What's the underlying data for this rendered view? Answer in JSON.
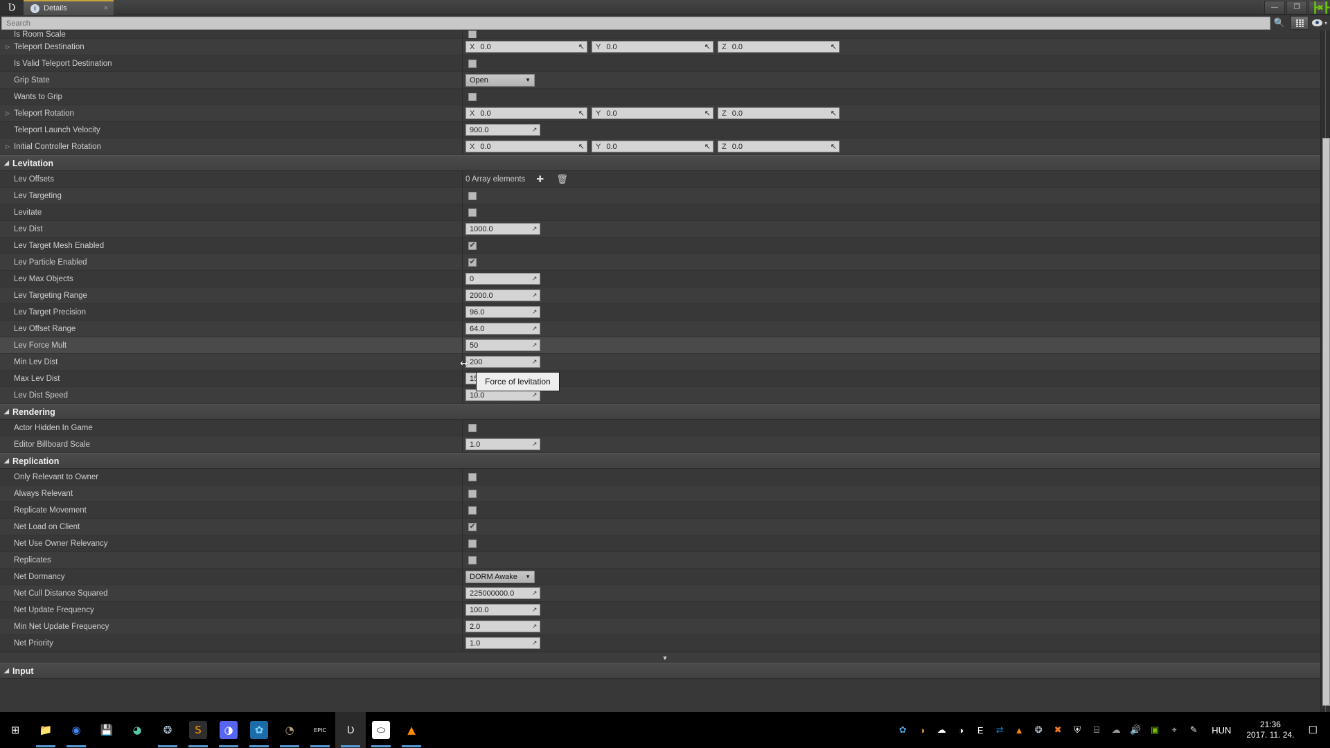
{
  "window": {
    "tab_label": "Details",
    "tab_icon": "info-icon",
    "tab_close": "×",
    "logo": "Ʋ",
    "minimize": "—",
    "restore": "❐",
    "close_overlay": "┣✖┣"
  },
  "search": {
    "placeholder": "Search",
    "value": "",
    "search_icon": "🔍",
    "eye_icon": "eye-icon",
    "chevron": "▾"
  },
  "rows": [
    {
      "label": "Is Room Scale",
      "type": "checkbox",
      "checked": false,
      "expander": false,
      "partial": true
    },
    {
      "label": "Teleport Destination",
      "type": "vector",
      "expander": true,
      "vector": [
        {
          "axis": "X",
          "value": "0.0"
        },
        {
          "axis": "Y",
          "value": "0.0"
        },
        {
          "axis": "Z",
          "value": "0.0"
        }
      ]
    },
    {
      "label": "Is Valid Teleport Destination",
      "type": "checkbox",
      "checked": false,
      "expander": false
    },
    {
      "label": "Grip State",
      "type": "combo",
      "value": "Open",
      "expander": false
    },
    {
      "label": "Wants to Grip",
      "type": "checkbox",
      "checked": false,
      "expander": false
    },
    {
      "label": "Teleport Rotation",
      "type": "vector",
      "expander": true,
      "vector": [
        {
          "axis": "X",
          "value": "0.0"
        },
        {
          "axis": "Y",
          "value": "0.0"
        },
        {
          "axis": "Z",
          "value": "0.0"
        }
      ]
    },
    {
      "label": "Teleport Launch Velocity",
      "type": "number",
      "value": "900.0",
      "expander": false
    },
    {
      "label": "Initial Controller Rotation",
      "type": "vector",
      "expander": true,
      "vector": [
        {
          "axis": "X",
          "value": "0.0"
        },
        {
          "axis": "Y",
          "value": "0.0"
        },
        {
          "axis": "Z",
          "value": "0.0"
        }
      ]
    },
    {
      "label": "Levitation",
      "type": "section"
    },
    {
      "label": "Lev Offsets",
      "type": "array",
      "value": "0 Array elements",
      "add_icon": "✚",
      "delete_icon": "🗑",
      "expander": false
    },
    {
      "label": "Lev Targeting",
      "type": "checkbox",
      "checked": false,
      "expander": false
    },
    {
      "label": "Levitate",
      "type": "checkbox",
      "checked": false,
      "expander": false
    },
    {
      "label": "Lev Dist",
      "type": "number",
      "value": "1000.0",
      "expander": false
    },
    {
      "label": "Lev Target Mesh Enabled",
      "type": "checkbox",
      "checked": true,
      "expander": false
    },
    {
      "label": "Lev Particle Enabled",
      "type": "checkbox",
      "checked": true,
      "expander": false
    },
    {
      "label": "Lev Max Objects",
      "type": "number",
      "value": "0",
      "expander": false
    },
    {
      "label": "Lev Targeting Range",
      "type": "number",
      "value": "2000.0",
      "expander": false
    },
    {
      "label": "Lev Target Precision",
      "type": "number",
      "value": "96.0",
      "expander": false
    },
    {
      "label": "Lev Offset Range",
      "type": "number",
      "value": "64.0",
      "expander": false
    },
    {
      "label": "Lev Force Mult",
      "type": "number",
      "value": "50",
      "expander": false,
      "hover": true
    },
    {
      "label": "Min Lev Dist",
      "type": "number",
      "value": "200",
      "expander": false
    },
    {
      "label": "Max Lev Dist",
      "type": "number",
      "value": "1500.0",
      "expander": false
    },
    {
      "label": "Lev Dist Speed",
      "type": "number",
      "value": "10.0",
      "expander": false
    },
    {
      "label": "Rendering",
      "type": "section"
    },
    {
      "label": "Actor Hidden In Game",
      "type": "checkbox",
      "checked": false,
      "expander": false
    },
    {
      "label": "Editor Billboard Scale",
      "type": "number",
      "value": "1.0",
      "expander": false
    },
    {
      "label": "Replication",
      "type": "section"
    },
    {
      "label": "Only Relevant to Owner",
      "type": "checkbox",
      "checked": false,
      "expander": false
    },
    {
      "label": "Always Relevant",
      "type": "checkbox",
      "checked": false,
      "expander": false
    },
    {
      "label": "Replicate Movement",
      "type": "checkbox",
      "checked": false,
      "expander": false
    },
    {
      "label": "Net Load on Client",
      "type": "checkbox",
      "checked": true,
      "expander": false
    },
    {
      "label": "Net Use Owner Relevancy",
      "type": "checkbox",
      "checked": false,
      "expander": false
    },
    {
      "label": "Replicates",
      "type": "checkbox",
      "checked": false,
      "expander": false
    },
    {
      "label": "Net Dormancy",
      "type": "combo",
      "value": "DORM Awake",
      "expander": false
    },
    {
      "label": "Net Cull Distance Squared",
      "type": "number",
      "value": "225000000.0",
      "expander": false
    },
    {
      "label": "Net Update Frequency",
      "type": "number",
      "value": "100.0",
      "expander": false
    },
    {
      "label": "Min Net Update Frequency",
      "type": "number",
      "value": "2.0",
      "expander": false
    },
    {
      "label": "Net Priority",
      "type": "number",
      "value": "1.0",
      "expander": false
    },
    {
      "label": "scroll",
      "type": "scrollarrow",
      "value": "▼"
    },
    {
      "label": "Input",
      "type": "section"
    }
  ],
  "tooltip": {
    "text": "Force of levitation"
  },
  "cursor": {
    "glyph": "↔"
  },
  "section_triangle": "◢",
  "expander_triangle": "▷",
  "taskbar": {
    "apps": [
      {
        "name": "start-button",
        "glyph": "⊞",
        "bg": "transparent",
        "fg": "#ffffff",
        "active": false,
        "underline": false
      },
      {
        "name": "file-explorer",
        "glyph": "📁",
        "bg": "transparent",
        "fg": "#f0c14b",
        "active": false,
        "underline": true
      },
      {
        "name": "google-chrome",
        "glyph": "◉",
        "bg": "transparent",
        "fg": "#4285f4",
        "active": false,
        "underline": true
      },
      {
        "name": "save-calendar-app",
        "glyph": "💾",
        "bg": "transparent",
        "fg": "#dbe4f0",
        "active": false,
        "underline": false
      },
      {
        "name": "disc-app",
        "glyph": "◕",
        "bg": "transparent",
        "fg": "#57c5a8",
        "active": false,
        "underline": false
      },
      {
        "name": "steam",
        "glyph": "❂",
        "bg": "transparent",
        "fg": "#bfd4e8",
        "active": false,
        "underline": true
      },
      {
        "name": "sublime-text",
        "glyph": "S",
        "bg": "#2e2e2e",
        "fg": "#ff9800",
        "active": false,
        "underline": true
      },
      {
        "name": "discord",
        "glyph": "◑",
        "bg": "#5865f2",
        "fg": "#ffffff",
        "active": false,
        "underline": true
      },
      {
        "name": "blender-app",
        "glyph": "✿",
        "bg": "#1b6ca8",
        "fg": "#7fd4ff",
        "active": false,
        "underline": true
      },
      {
        "name": "gimp",
        "glyph": "◔",
        "bg": "transparent",
        "fg": "#b9a37e",
        "active": false,
        "underline": true
      },
      {
        "name": "epic-games",
        "glyph": "EPIC",
        "bg": "transparent",
        "fg": "#f2f2f2",
        "active": false,
        "underline": true
      },
      {
        "name": "unreal-engine",
        "glyph": "Ʋ",
        "bg": "transparent",
        "fg": "#e8e8e8",
        "active": true,
        "underline": true
      },
      {
        "name": "oculus-app",
        "glyph": "⬭",
        "bg": "#ffffff",
        "fg": "#000000",
        "active": false,
        "underline": true
      },
      {
        "name": "vlc-media-player",
        "glyph": "▲",
        "bg": "transparent",
        "fg": "#ff8c00",
        "active": false,
        "underline": true
      }
    ],
    "tray": [
      {
        "name": "blender-tray-icon",
        "glyph": "✿",
        "fg": "#4aa3e0"
      },
      {
        "name": "sun-tray-icon",
        "glyph": "◑",
        "fg": "#e8a33d"
      },
      {
        "name": "onedrive-icon",
        "glyph": "☁",
        "fg": "#ffffff"
      },
      {
        "name": "discord-tray-icon",
        "glyph": "◑",
        "fg": "#ffffff"
      },
      {
        "name": "epic-tray-icon",
        "glyph": "E",
        "fg": "#ffffff"
      },
      {
        "name": "teamviewer-icon",
        "glyph": "⇄",
        "fg": "#0e8ee9"
      },
      {
        "name": "vlc-tray-icon",
        "glyph": "▲",
        "fg": "#ff8c00"
      },
      {
        "name": "steam-tray-icon",
        "glyph": "❂",
        "fg": "#c7d8e8"
      },
      {
        "name": "xampp-icon",
        "glyph": "✖",
        "fg": "#fb7a24"
      },
      {
        "name": "windows-defender-icon",
        "glyph": "⛨",
        "fg": "#ffffff"
      },
      {
        "name": "network-icon",
        "glyph": "⌸",
        "fg": "#ffffff"
      },
      {
        "name": "cloud-icon",
        "glyph": "☁",
        "fg": "#9a9a9a"
      },
      {
        "name": "volume-icon",
        "glyph": "🔊",
        "fg": "#ffffff"
      },
      {
        "name": "nvidia-icon",
        "glyph": "▣",
        "fg": "#76b900"
      },
      {
        "name": "mouse-tray-icon",
        "glyph": "⌖",
        "fg": "#cfcfcf"
      },
      {
        "name": "pen-tray-icon",
        "glyph": "✎",
        "fg": "#e0e0e0"
      }
    ],
    "language": "HUN",
    "time": "21:36",
    "date": "2017. 11. 24.",
    "notification_icon": "☐"
  }
}
